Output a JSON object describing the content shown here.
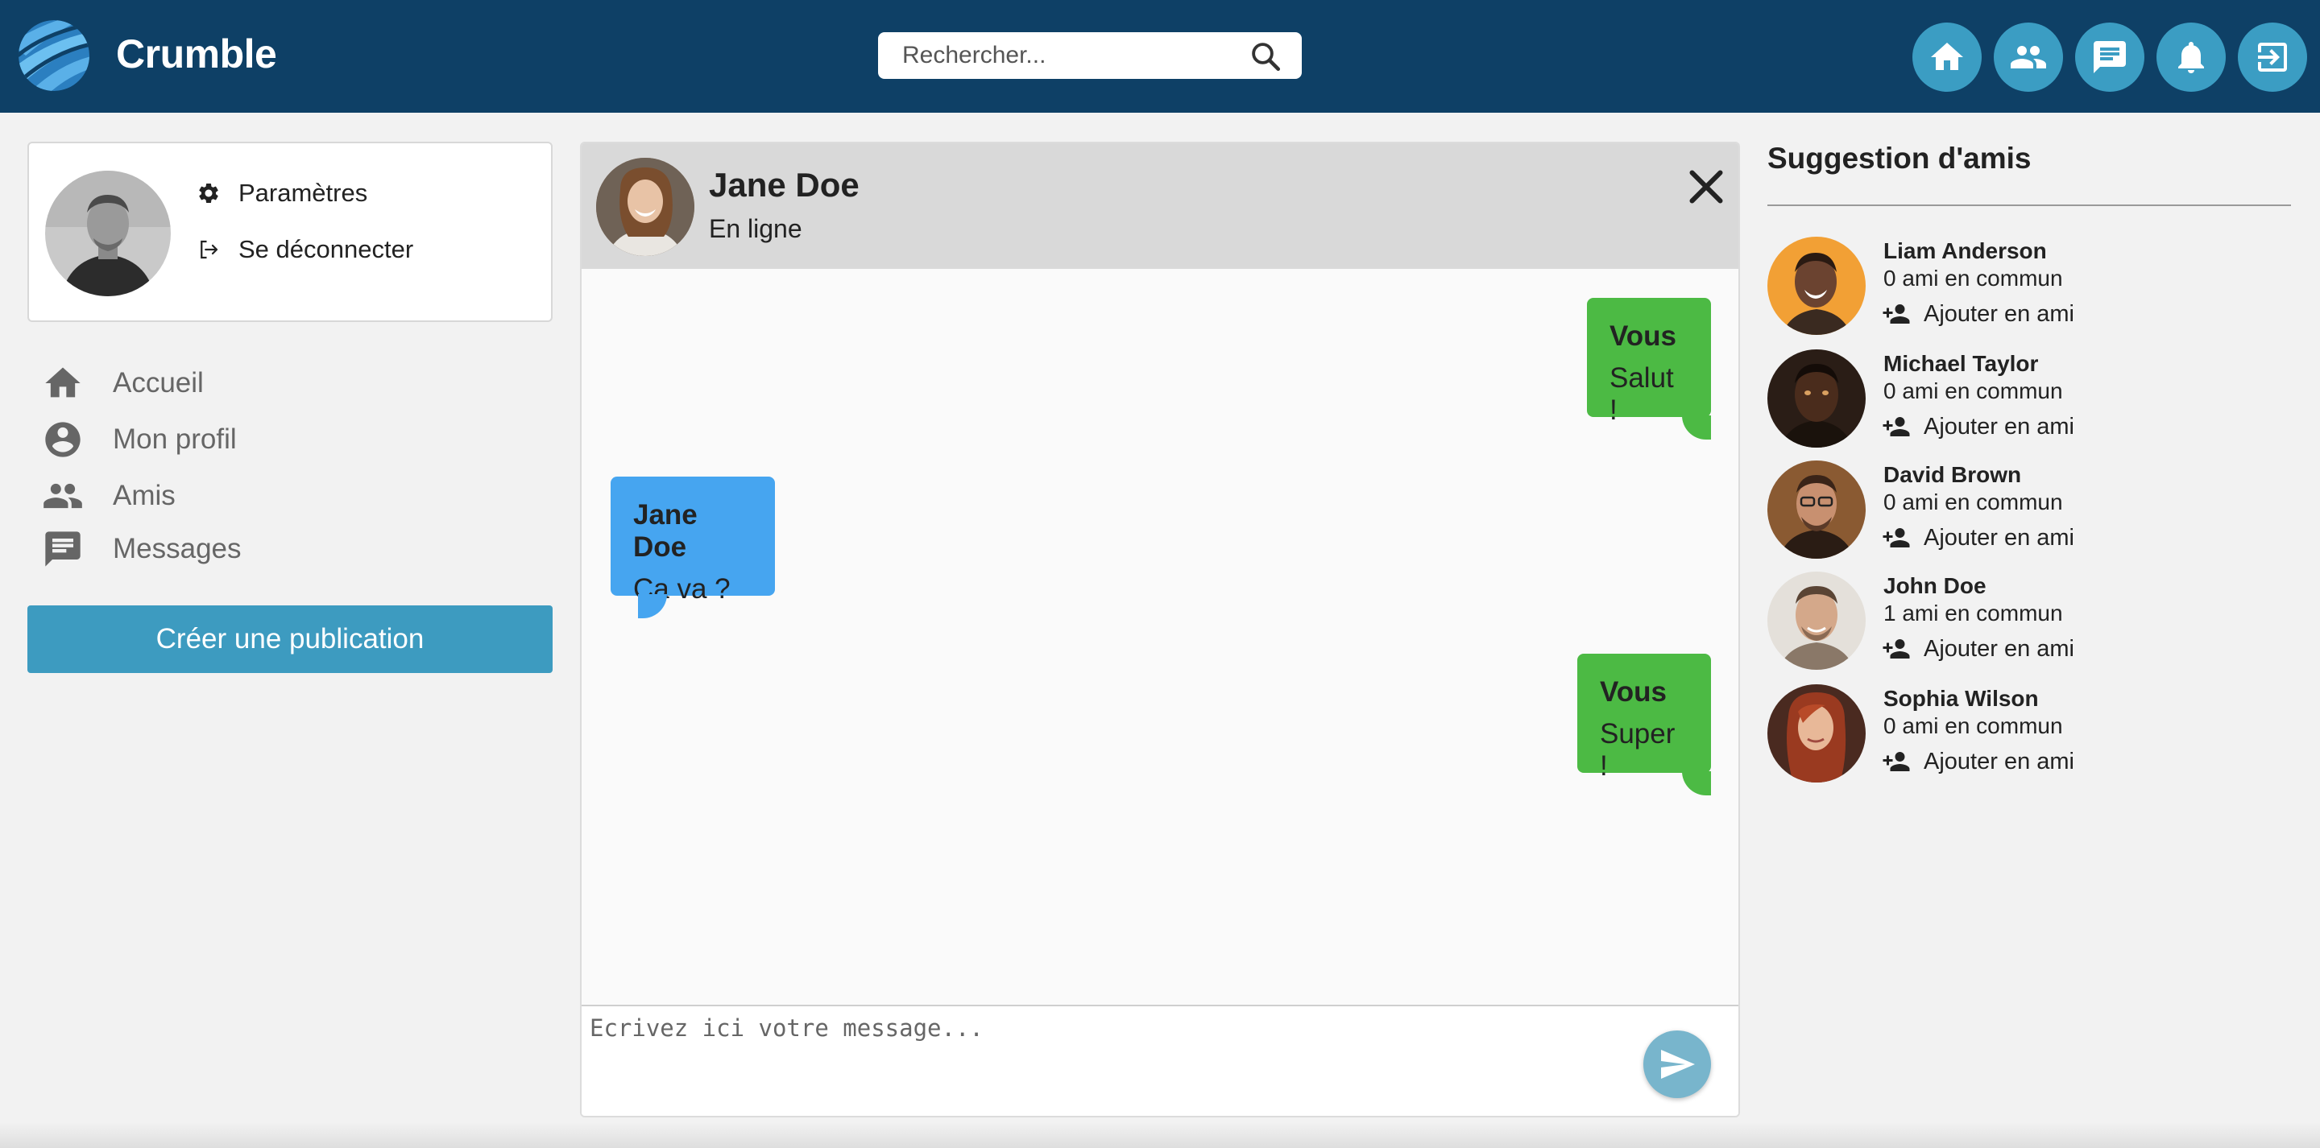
{
  "header": {
    "brand": "Crumble",
    "search_placeholder": "Rechercher...",
    "nav_icons": [
      "home-icon",
      "friends-icon",
      "messages-icon",
      "notifications-icon",
      "logout-icon"
    ],
    "color": "#0e4066",
    "button_color": "#3b9dc3"
  },
  "profile_card": {
    "settings_label": "Paramètres",
    "logout_label": "Se déconnecter"
  },
  "sidebar": {
    "items": [
      {
        "label": "Accueil",
        "icon": "home-icon"
      },
      {
        "label": "Mon profil",
        "icon": "account-icon"
      },
      {
        "label": "Amis",
        "icon": "people-icon"
      },
      {
        "label": "Messages",
        "icon": "message-icon"
      }
    ],
    "create_post_label": "Créer une publication",
    "create_post_color": "#3d9bc0"
  },
  "chat": {
    "contact_name": "Jane Doe",
    "contact_status": "En ligne",
    "messages": [
      {
        "sender": "Vous",
        "text": "Salut !",
        "mine": true
      },
      {
        "sender": "Jane Doe",
        "text": "Ça va ?",
        "mine": false
      },
      {
        "sender": "Vous",
        "text": "Super !",
        "mine": true
      }
    ],
    "composer_placeholder": "Ecrivez ici votre message...",
    "my_bubble_color": "#4cba44",
    "their_bubble_color": "#46a5f0"
  },
  "suggestions": {
    "title": "Suggestion d'amis",
    "add_label": "Ajouter en ami",
    "friends": [
      {
        "name": "Liam Anderson",
        "common": "0 ami en commun"
      },
      {
        "name": "Michael Taylor",
        "common": "0 ami en commun"
      },
      {
        "name": "David Brown",
        "common": "0 ami en commun"
      },
      {
        "name": "John Doe",
        "common": "1 ami en commun"
      },
      {
        "name": "Sophia Wilson",
        "common": "0 ami en commun"
      }
    ]
  }
}
